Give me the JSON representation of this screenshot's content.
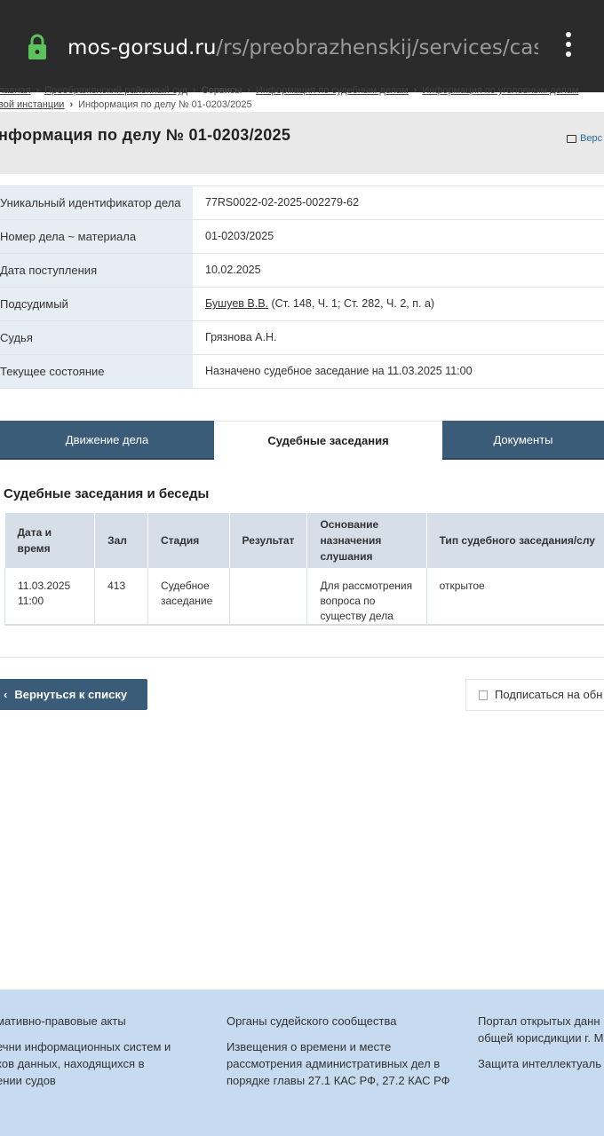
{
  "browser": {
    "url_host": "mos-gorsud.ru",
    "url_path": "/rs/preobrazhenskij/services/cases/c"
  },
  "breadcrumb": {
    "row1": [
      "лавная",
      "Преображенский районный суд",
      "Сервисы",
      "Информация по судебным делам",
      "Информация по уголовным делам"
    ],
    "row2": [
      "вой инстанции",
      "Информация по делу № 01-0203/2025"
    ]
  },
  "page": {
    "title": "нформация по делу № 01-0203/2025",
    "print_label": "Верс"
  },
  "case_info": [
    {
      "label": "Уникальный идентификатор дела",
      "value": "77RS0022-02-2025-002279-62"
    },
    {
      "label": "Номер дела ~ материала",
      "value": "01-0203/2025"
    },
    {
      "label": "Дата поступления",
      "value": "10.02.2025"
    },
    {
      "label": "Подсудимый",
      "value_link": "Бушуев В.В.",
      "value": " (Ст. 148, Ч. 1; Ст. 282, Ч. 2, п. а)"
    },
    {
      "label": "Судья",
      "value": "Грязнова А.Н."
    },
    {
      "label": "Текущее состояние",
      "value": "Назначено судебное заседание на 11.03.2025 11:00"
    }
  ],
  "tabs": [
    {
      "label": "Движение дела",
      "active": false
    },
    {
      "label": "Судебные заседания",
      "active": true
    },
    {
      "label": "Документы",
      "active": false
    }
  ],
  "sessions": {
    "title": "Судебные заседания и беседы",
    "headers": [
      "Дата и время",
      "Зал",
      "Стадия",
      "Результат",
      "Основание назначения слушания",
      "Тип судебного заседания/слу"
    ],
    "rows": [
      [
        "11.03.2025 11:00",
        "413",
        "Судебное заседание",
        "",
        "Для рассмотрения вопроса по существу дела",
        "открытое"
      ]
    ]
  },
  "actions": {
    "back_label": "Вернуться к списку",
    "subscribe_label": "Подписаться на обн"
  },
  "footer": {
    "col1": [
      "мативно-правовые акты",
      "ечни информационных систем и\nков данных, находящихся в\nении судов"
    ],
    "col2": [
      "Органы судейского сообщества",
      "Извещения о времени и месте\nрассмотрения административных дел в\nпорядке главы 27.1 КАС РФ, 27.2 КАС РФ"
    ],
    "col3": [
      "Портал открытых данн\nобщей юрисдикции г. М",
      "Защита интеллектуаль"
    ]
  },
  "colors": {
    "accent": "#3b5c78",
    "browser_bar": "#2b2b2b",
    "lock": "#5cc35c",
    "footer_bg": "#c6daf0"
  }
}
